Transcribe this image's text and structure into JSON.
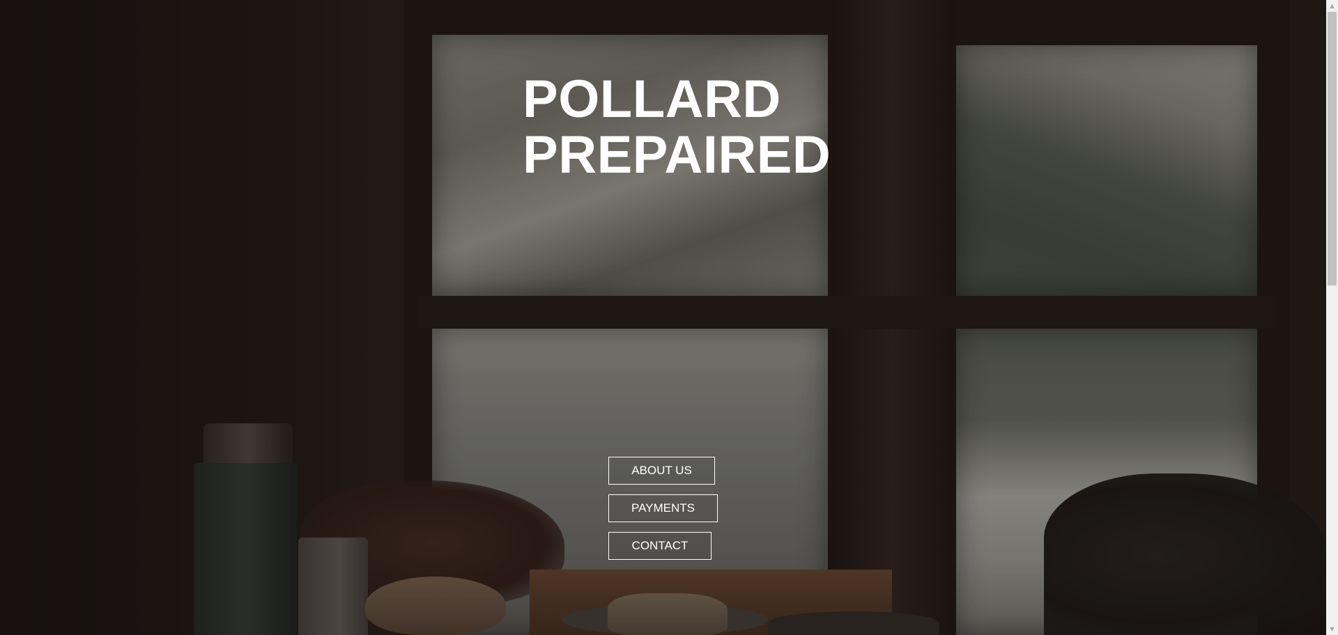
{
  "hero": {
    "title_line1": "POLLARD",
    "title_line2": "PREPAIRED"
  },
  "nav": {
    "items": [
      {
        "label": "ABOUT US"
      },
      {
        "label": "PAYMENTS"
      },
      {
        "label": "CONTACT"
      }
    ]
  },
  "scrollbar": {
    "up_icon": "▲",
    "down_icon": "▼"
  }
}
